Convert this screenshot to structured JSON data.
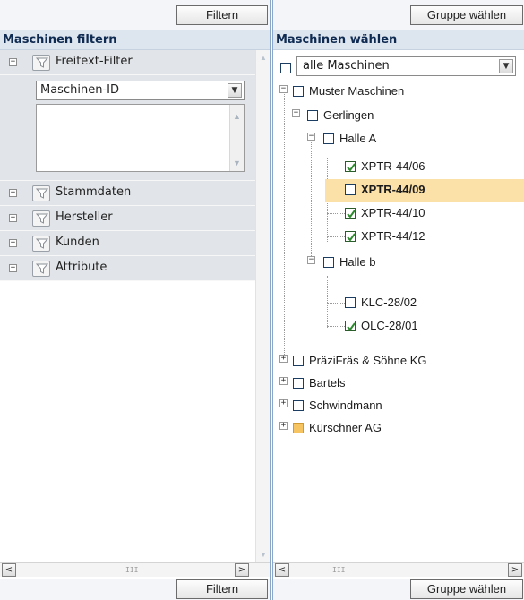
{
  "left": {
    "top_button": "Filtern",
    "title": "Maschinen filtern",
    "groups": [
      {
        "label": "Freitext-Filter",
        "expanded": true
      },
      {
        "label": "Stammdaten",
        "expanded": false
      },
      {
        "label": "Hersteller",
        "expanded": false
      },
      {
        "label": "Kunden",
        "expanded": false
      },
      {
        "label": "Attribute",
        "expanded": false
      }
    ],
    "freitext_select": "Maschinen-ID",
    "freitext_textarea": "",
    "bottom_button": "Filtern",
    "icons": {
      "expanded": "minus-icon",
      "collapsed": "plus-icon",
      "filter": "funnel-icon",
      "dropdown": "chevron-down-icon"
    }
  },
  "right": {
    "top_button": "Gruppe wählen",
    "title": "Maschinen wählen",
    "all_select": "alle Maschinen",
    "tree": [
      {
        "label": "Muster Maschinen",
        "state": "unchecked"
      },
      {
        "label": "Gerlingen",
        "state": "unchecked"
      },
      {
        "label": "Halle A",
        "state": "unchecked"
      },
      {
        "label": "XPTR-44/06",
        "state": "checked"
      },
      {
        "label": "XPTR-44/09",
        "state": "unchecked",
        "selected": true
      },
      {
        "label": "XPTR-44/10",
        "state": "checked"
      },
      {
        "label": "XPTR-44/12",
        "state": "checked"
      },
      {
        "label": "Halle b",
        "state": "unchecked"
      },
      {
        "label": "KLC-28/02",
        "state": "unchecked"
      },
      {
        "label": "OLC-28/01",
        "state": "checked"
      },
      {
        "label": "PräziFräs & Söhne KG",
        "state": "unchecked"
      },
      {
        "label": "Bartels",
        "state": "unchecked"
      },
      {
        "label": "Schwindmann",
        "state": "unchecked"
      },
      {
        "label": "Kürschner AG",
        "state": "partial"
      }
    ],
    "bottom_button": "Gruppe wählen",
    "colors": {
      "selected_row": "#fbe0a8",
      "partial_checkbox": "#f6c561",
      "check_mark": "#2f8a2f"
    }
  }
}
